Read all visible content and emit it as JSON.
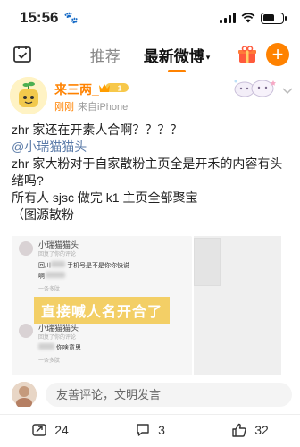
{
  "status_bar": {
    "time": "15:56",
    "paw_icon": "paw-icon",
    "battery_level": 0.6
  },
  "nav": {
    "tabs": [
      {
        "label": "推荐",
        "active": false
      },
      {
        "label": "最新微博",
        "active": true
      }
    ],
    "active_caret": "▾",
    "plus_label": "+"
  },
  "post": {
    "username": "来三两_",
    "vip_level": "1",
    "meta_new": "刚刚",
    "meta_source": "来自iPhone",
    "lines": [
      "zhr 家还在开素人合啊？？？？",
      "@小瑞猫猫头",
      "zhr 家大粉对于自家散粉主页全是开禾的内容有头",
      "绪吗?",
      "所有人 sjsc 做完 k1 主页全部聚宝",
      "（图源散粉"
    ],
    "mention_index": 1
  },
  "image": {
    "comment1_name": "小瑞猫猫头",
    "comment1_sub": "回复了你的评论",
    "comment1_text_a": "回川",
    "comment1_text_b": "手机号是不是你你快说",
    "comment1_text_c": "啊",
    "comment1_footer": "一条多肽",
    "overlay": "直接喊人名开合了",
    "comment2_name": "小瑞猫猫头",
    "comment2_sub": "回复了你的评论",
    "comment2_text": "你啥意思",
    "comment2_footer": "一条多肽"
  },
  "comment_bar": {
    "placeholder": "友善评论，文明发言"
  },
  "actions": [
    {
      "icon": "repost-icon",
      "count": "24"
    },
    {
      "icon": "comment-icon",
      "count": "3"
    },
    {
      "icon": "like-icon",
      "count": "32"
    }
  ],
  "colors": {
    "accent": "#ff8200",
    "mention": "#5b7ba8",
    "overlay": "#f3cf66"
  }
}
